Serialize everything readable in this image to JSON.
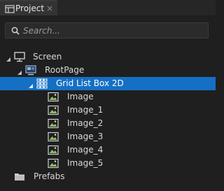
{
  "tab": {
    "title": "Project",
    "close": "×"
  },
  "search": {
    "placeholder": "Search..."
  },
  "tree": {
    "screen": {
      "label": "Screen"
    },
    "rootpage": {
      "label": "RootPage"
    },
    "gridlistbox": {
      "label": "Grid List Box 2D",
      "selected": true
    },
    "images": [
      {
        "label": "Image"
      },
      {
        "label": "Image_1"
      },
      {
        "label": "Image_2"
      },
      {
        "label": "Image_3"
      },
      {
        "label": "Image_4"
      },
      {
        "label": "Image_5"
      }
    ],
    "prefabs": {
      "label": "Prefabs"
    }
  },
  "colors": {
    "selection": "#1570c4",
    "background": "#1f1f1f"
  },
  "icons": [
    "project-icon",
    "close-icon",
    "search-icon",
    "screen-icon",
    "page-icon",
    "grid-list-box-icon",
    "image-icon",
    "folder-icon",
    "expand-arrow-icon"
  ]
}
